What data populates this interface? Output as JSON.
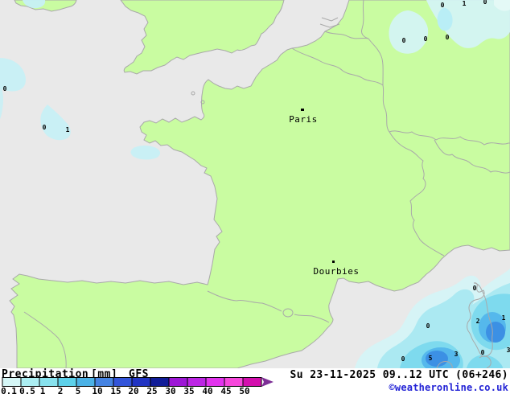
{
  "legend": {
    "title": "Precipitation",
    "units": "[mm]",
    "model": "GFS",
    "ticks": [
      "0.1",
      "0.5",
      "1",
      "2",
      "5",
      "10",
      "15",
      "20",
      "25",
      "30",
      "35",
      "40",
      "45",
      "50"
    ],
    "colors": [
      "#d5f6f6",
      "#aceef2",
      "#88e2ee",
      "#5dd1ea",
      "#4cb2e6",
      "#4583e2",
      "#3355da",
      "#2134c2",
      "#111d98",
      "#9d17d6",
      "#bc25e4",
      "#e233ee",
      "#f747dc",
      "#d40fae"
    ],
    "arrow_color": "#7d2f96"
  },
  "footer": {
    "datetime": "Su 23-11-2025 09..12 UTC (06+246)",
    "copyright": "©weatheronline.co.uk"
  },
  "map": {
    "cities": [
      "Paris",
      "Dourbies"
    ],
    "value_labels": [
      "0",
      "0",
      "1",
      "0",
      "1",
      "0",
      "0",
      "0",
      "0",
      "0",
      "2",
      "1",
      "0",
      "5",
      "3",
      "0",
      "3",
      "0"
    ],
    "colors": {
      "sea": "#e9e9e9",
      "land": "#c9fca1",
      "border": "#a9a9a9",
      "label": "#000000",
      "copyright_blue": "#2424d6",
      "precip_01": "#d4f4f6",
      "precip_05": "#abe9f2",
      "precip_1": "#7edaee",
      "precip_2": "#55b8ec",
      "precip_5": "#3c90e4",
      "precip_light": "#c7f0f6",
      "precip_inner": "#b9eef6",
      "precip_pale": "#e4f9f6"
    }
  }
}
